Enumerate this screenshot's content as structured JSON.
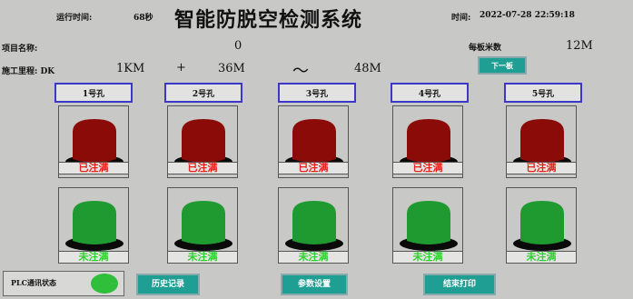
{
  "header": {
    "runtime_label": "运行时间:",
    "runtime_value": "68秒",
    "title": "智能防脱空检测系统",
    "time_label": "时间:",
    "time_value": "2022-07-28 22:59:18"
  },
  "info": {
    "project_label": "项目名称:",
    "project_value": "0",
    "mileage_label": "施工里程: DK",
    "mileage_km": "1KM",
    "plus": "+",
    "mileage_from": "36M",
    "tilde": "～",
    "mileage_to": "48M",
    "per_board_label": "每板米数",
    "per_board_value": "12M",
    "next_button": "下一板"
  },
  "holes": [
    {
      "label": "1号孔",
      "top_status": "已注满",
      "bottom_status": "未注满"
    },
    {
      "label": "2号孔",
      "top_status": "已注满",
      "bottom_status": "未注满"
    },
    {
      "label": "3号孔",
      "top_status": "已注满",
      "bottom_status": "未注满"
    },
    {
      "label": "4号孔",
      "top_status": "已注满",
      "bottom_status": "未注满"
    },
    {
      "label": "5号孔",
      "top_status": "已注满",
      "bottom_status": "未注满"
    }
  ],
  "footer": {
    "plc_label": "PLC通讯状态",
    "history_button": "历史记录",
    "params_button": "参数设置",
    "print_button": "结束打印"
  },
  "colors": {
    "red_lamp": "#8a0b08",
    "green_lamp": "#1e9a30",
    "filled_text": "#e8201a",
    "unfilled_text": "#2fd02f",
    "button_teal": "#1f9f93",
    "label_border": "#3d37c9",
    "plc_indicator": "#2fbf3a"
  }
}
